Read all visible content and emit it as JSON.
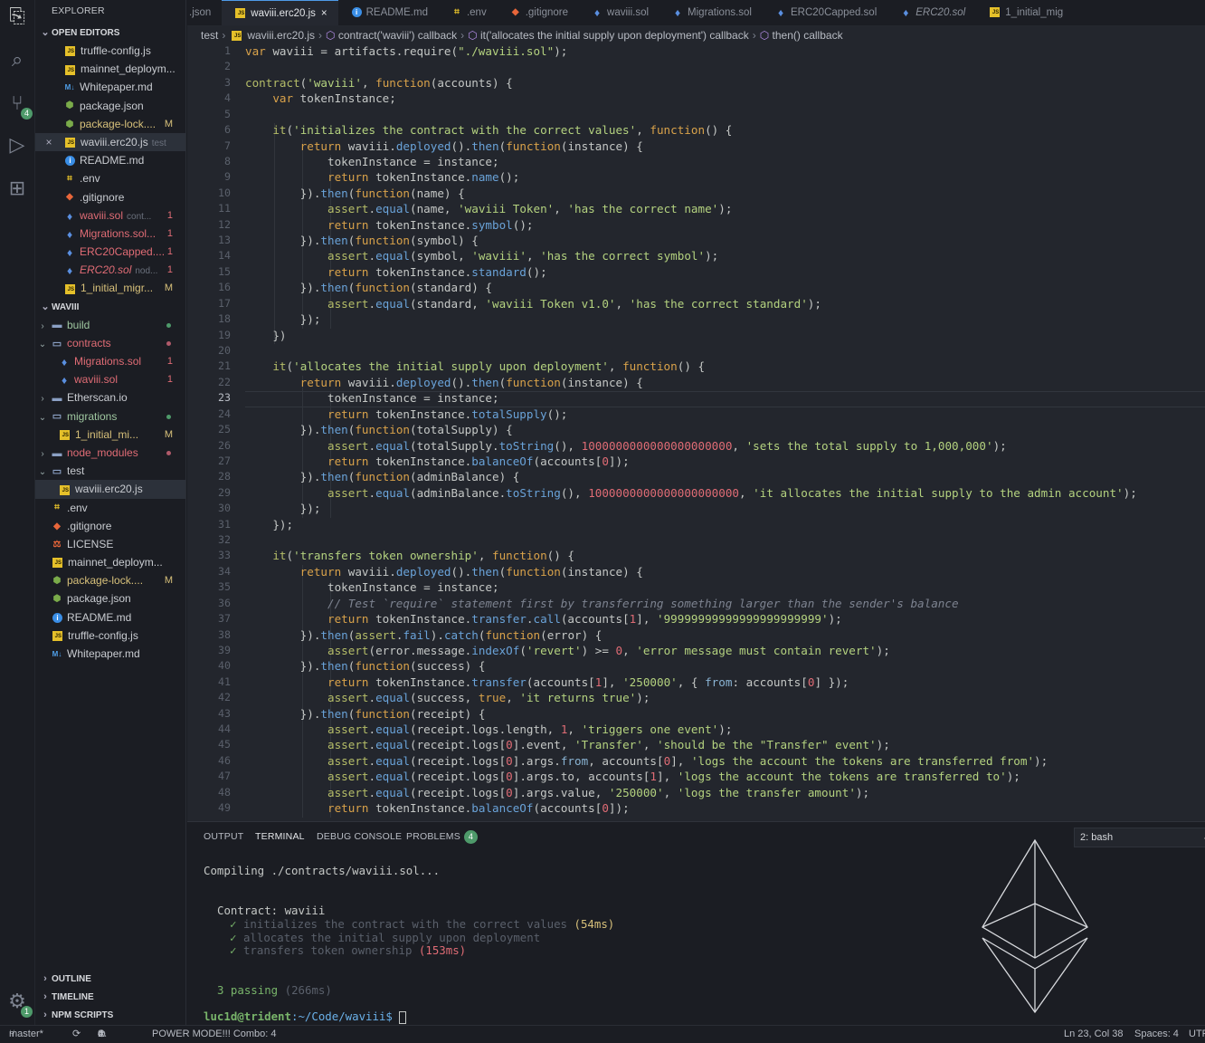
{
  "activity": {
    "scm_badge": "4",
    "settings_badge": "1"
  },
  "sidebar": {
    "title": "EXPLORER",
    "open_editors_title": "OPEN EDITORS",
    "open_editors": [
      {
        "icon": "js",
        "name": "truffle-config.js",
        "mark": ""
      },
      {
        "icon": "js",
        "name": "mainnet_deploym...",
        "mark": ""
      },
      {
        "icon": "md",
        "name": "Whitepaper.md",
        "mark": ""
      },
      {
        "icon": "pkg",
        "name": "package.json",
        "mark": ""
      },
      {
        "icon": "pkg",
        "name": "package-lock....",
        "mark": "M"
      },
      {
        "icon": "js",
        "name": "waviii.erc20.js",
        "hint": "test",
        "mark": "",
        "selected": true
      },
      {
        "icon": "info",
        "name": "README.md",
        "mark": ""
      },
      {
        "icon": "env",
        "name": ".env",
        "mark": ""
      },
      {
        "icon": "git",
        "name": ".gitignore",
        "mark": ""
      },
      {
        "icon": "eth",
        "name": "waviii.sol",
        "hint": "cont...",
        "mark": "1"
      },
      {
        "icon": "eth",
        "name": "Migrations.sol...",
        "mark": "1"
      },
      {
        "icon": "eth",
        "name": "ERC20Capped....",
        "mark": "1"
      },
      {
        "icon": "eth",
        "name": "ERC20.sol",
        "hint": "nod...",
        "mark": "1"
      },
      {
        "icon": "js",
        "name": "1_initial_migr...",
        "mark": "M"
      }
    ],
    "project_title": "WAVIII",
    "tree": [
      {
        "name": "build",
        "kind": "folder",
        "level": 0,
        "dot": "g"
      },
      {
        "name": "contracts",
        "kind": "folder-open",
        "level": 0,
        "dot": "r"
      },
      {
        "name": "Migrations.sol",
        "kind": "eth",
        "level": 1,
        "mark": "1"
      },
      {
        "name": "waviii.sol",
        "kind": "eth",
        "level": 1,
        "mark": "1"
      },
      {
        "name": "Etherscan.io",
        "kind": "folder",
        "level": 0
      },
      {
        "name": "migrations",
        "kind": "folder-open",
        "level": 0,
        "dot": "g"
      },
      {
        "name": "1_initial_mi...",
        "kind": "js",
        "level": 1,
        "mark": "M"
      },
      {
        "name": "node_modules",
        "kind": "folder",
        "level": 0,
        "dot": "r"
      },
      {
        "name": "test",
        "kind": "folder-open",
        "level": 0
      },
      {
        "name": "waviii.erc20.js",
        "kind": "js",
        "level": 1,
        "selected": true
      },
      {
        "name": ".env",
        "kind": "env",
        "level": 0
      },
      {
        "name": ".gitignore",
        "kind": "git",
        "level": 0
      },
      {
        "name": "LICENSE",
        "kind": "lic",
        "level": 0
      },
      {
        "name": "mainnet_deploym...",
        "kind": "js",
        "level": 0
      },
      {
        "name": "package-lock....",
        "kind": "pkg",
        "level": 0,
        "mark": "M"
      },
      {
        "name": "package.json",
        "kind": "pkg",
        "level": 0
      },
      {
        "name": "README.md",
        "kind": "info",
        "level": 0
      },
      {
        "name": "truffle-config.js",
        "kind": "js",
        "level": 0
      },
      {
        "name": "Whitepaper.md",
        "kind": "md",
        "level": 0
      }
    ],
    "outline": "OUTLINE",
    "timeline": "TIMELINE",
    "npm": "NPM SCRIPTS"
  },
  "tabs": [
    {
      "label": ".json",
      "icon": "",
      "active": false
    },
    {
      "label": "waviii.erc20.js",
      "icon": "js",
      "active": true,
      "close": "×"
    },
    {
      "label": "README.md",
      "icon": "info",
      "active": false
    },
    {
      "label": ".env",
      "icon": "env",
      "active": false
    },
    {
      "label": ".gitignore",
      "icon": "git",
      "active": false
    },
    {
      "label": "waviii.sol",
      "icon": "eth",
      "active": false
    },
    {
      "label": "Migrations.sol",
      "icon": "eth",
      "active": false
    },
    {
      "label": "ERC20Capped.sol",
      "icon": "eth",
      "active": false
    },
    {
      "label": "ERC20.sol",
      "icon": "eth",
      "active": false,
      "italic": true
    },
    {
      "label": "1_initial_mig",
      "icon": "js",
      "active": false
    }
  ],
  "breadcrumb": [
    "test",
    "waviii.erc20.js",
    "contract('waviii') callback",
    "it('allocates the initial supply upon deployment') callback",
    "then() callback"
  ],
  "editor": {
    "current_line": 23,
    "lines": [
      "var waviii = artifacts.require(\"./waviii.sol\");",
      "",
      "contract('waviii', function(accounts) {",
      "    var tokenInstance;",
      "",
      "    it('initializes the contract with the correct values', function() {",
      "        return waviii.deployed().then(function(instance) {",
      "            tokenInstance = instance;",
      "            return tokenInstance.name();",
      "        }).then(function(name) {",
      "            assert.equal(name, 'waviii Token', 'has the correct name');",
      "            return tokenInstance.symbol();",
      "        }).then(function(symbol) {",
      "            assert.equal(symbol, 'waviii', 'has the correct symbol');",
      "            return tokenInstance.standard();",
      "        }).then(function(standard) {",
      "            assert.equal(standard, 'waviii Token v1.0', 'has the correct standard');",
      "        });",
      "    })",
      "",
      "    it('allocates the initial supply upon deployment', function() {",
      "        return waviii.deployed().then(function(instance) {",
      "            tokenInstance = instance;",
      "            return tokenInstance.totalSupply();",
      "        }).then(function(totalSupply) {",
      "            assert.equal(totalSupply.toString(), 1000000000000000000000, 'sets the total supply to 1,000,000');",
      "            return tokenInstance.balanceOf(accounts[0]);",
      "        }).then(function(adminBalance) {",
      "            assert.equal(adminBalance.toString(), 1000000000000000000000, 'it allocates the initial supply to the admin account');",
      "        });",
      "    });",
      "",
      "    it('transfers token ownership', function() {",
      "        return waviii.deployed().then(function(instance) {",
      "            tokenInstance = instance;",
      "            // Test `require` statement first by transferring something larger than the sender's balance",
      "            return tokenInstance.transfer.call(accounts[1], '99999999999999999999999');",
      "        }).then(assert.fail).catch(function(error) {",
      "            assert(error.message.indexOf('revert') >= 0, 'error message must contain revert');",
      "        }).then(function(success) {",
      "            return tokenInstance.transfer(accounts[1], '250000', { from: accounts[0] });",
      "            assert.equal(success, true, 'it returns true');",
      "        }).then(function(receipt) {",
      "            assert.equal(receipt.logs.length, 1, 'triggers one event');",
      "            assert.equal(receipt.logs[0].event, 'Transfer', 'should be the \"Transfer\" event');",
      "            assert.equal(receipt.logs[0].args.from, accounts[0], 'logs the account the tokens are transferred from');",
      "            assert.equal(receipt.logs[0].args.to, accounts[1], 'logs the account the tokens are transferred to');",
      "            assert.equal(receipt.logs[0].args.value, '250000', 'logs the transfer amount');",
      "            return tokenInstance.balanceOf(accounts[0]);"
    ]
  },
  "panel": {
    "tabs": [
      "OUTPUT",
      "TERMINAL",
      "DEBUG CONSOLE",
      "PROBLEMS"
    ],
    "problems_count": "4",
    "terminal_select": "2: bash",
    "terminal": {
      "compiling": "Compiling ./contracts/waviii.sol...",
      "contract": "Contract: waviii",
      "tests": [
        {
          "check": "✓",
          "text": "initializes the contract with the correct values",
          "time": "(54ms)"
        },
        {
          "check": "✓",
          "text": "allocates the initial supply upon deployment",
          "time": ""
        },
        {
          "check": "✓",
          "text": "transfers token ownership",
          "time": "(153ms)"
        }
      ],
      "passing": "3 passing",
      "passing_time": "(266ms)",
      "prompt_user": "luc1d@trident",
      "prompt_path": ":~/Code/waviii$"
    }
  },
  "status": {
    "branch": "master*",
    "errors": "4",
    "warnings": "0",
    "power_mode": "POWER MODE!!! Combo: 4",
    "position": "Ln 23, Col 38",
    "spaces": "Spaces: 4",
    "encoding": "UTF"
  },
  "colors": {
    "accent": "#4e9ae8",
    "badge": "#4e9a6a",
    "keyword": "#d9a24a",
    "string": "#b4d27f",
    "number": "#e06c75"
  }
}
